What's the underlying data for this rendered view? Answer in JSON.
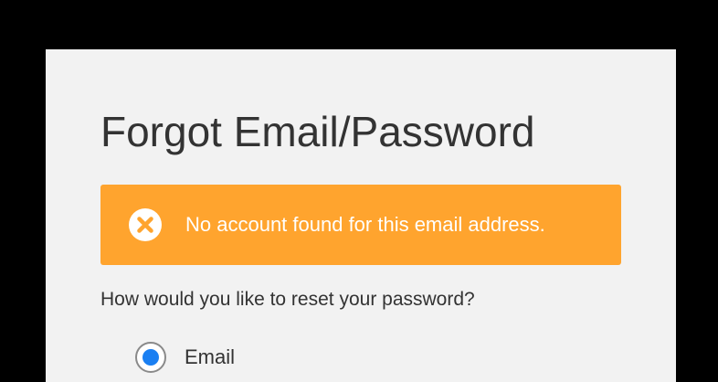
{
  "dialog": {
    "title": "Forgot Email/Password"
  },
  "alert": {
    "icon": "error-x-circle-icon",
    "message": "No account found for this email address.",
    "background_color": "#ffa42e"
  },
  "reset": {
    "question": "How would you like to reset your password?",
    "options": [
      {
        "label": "Email",
        "selected": true
      }
    ],
    "selected_color": "#1a7ff2"
  }
}
